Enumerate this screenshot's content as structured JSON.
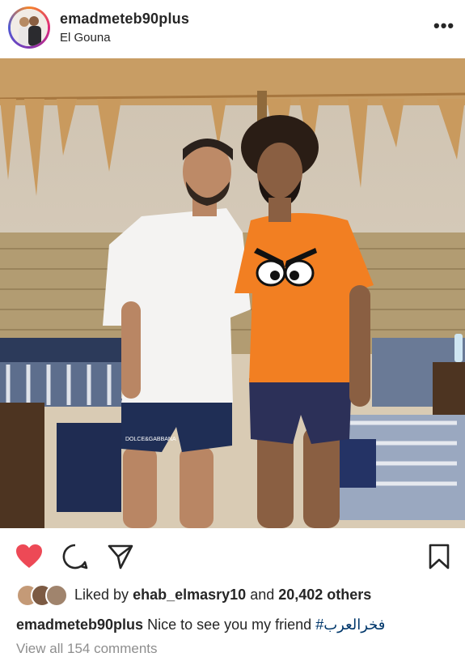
{
  "post": {
    "username": "emadmeteb90plus",
    "location": "El Gouna",
    "more_icon": "more-options-icon",
    "more_glyph": "•••"
  },
  "photo": {
    "alt": "Two men posing under a straw beach umbrella",
    "shorts_logo": "DOLCE&GABBANA"
  },
  "actions": {
    "like_icon": "heart-filled-icon",
    "comment_icon": "comment-icon",
    "share_icon": "share-icon",
    "save_icon": "bookmark-icon",
    "like_color": "#ed4956"
  },
  "likes": {
    "prefix": "Liked by",
    "user": "ehab_elmasry10",
    "middle": "and",
    "count": "20,402 others"
  },
  "caption": {
    "username": "emadmeteb90plus",
    "text": "Nice to see you my friend",
    "hashtag": "#فخرالعرب"
  },
  "comments": {
    "link": "View all 154 comments"
  }
}
